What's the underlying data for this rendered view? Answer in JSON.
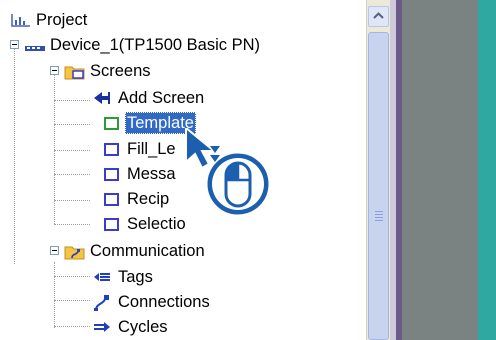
{
  "tree": {
    "project_label": "Project",
    "device_label": "Device_1(TP1500 Basic PN)",
    "screens_folder_label": "Screens",
    "screens": [
      {
        "label": "Add Screen",
        "icon": "add-screen-icon"
      },
      {
        "label": "Template",
        "icon": "template-screen-icon",
        "selected": true
      },
      {
        "label": "Fill_Le",
        "icon": "screen-icon"
      },
      {
        "label": "Messa",
        "icon": "screen-icon"
      },
      {
        "label": "Recip",
        "icon": "screen-icon"
      },
      {
        "label": "Selectio",
        "icon": "screen-icon"
      }
    ],
    "communication_folder_label": "Communication",
    "communication": [
      {
        "label": "Tags",
        "icon": "tags-icon"
      },
      {
        "label": "Connections",
        "icon": "connections-icon"
      },
      {
        "label": "Cycles",
        "icon": "cycles-icon"
      }
    ]
  },
  "colors": {
    "selection": "#316ac5",
    "screen_icon_border": "#3b3bd0",
    "template_icon_border": "#2e9b3a",
    "folder_yellow": "#f5c542"
  },
  "overlay": {
    "cursor": "pointer-arrow-icon",
    "gesture": "mouse-left-click-icon"
  }
}
